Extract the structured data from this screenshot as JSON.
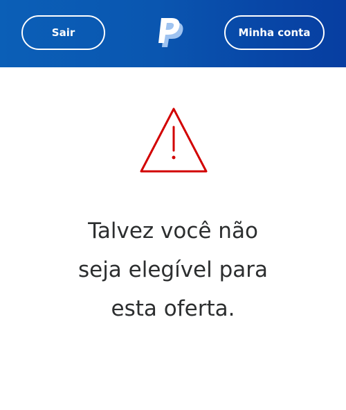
{
  "header": {
    "logout_label": "Sair",
    "account_label": "Minha conta",
    "logo_icon": "paypal-logo-icon",
    "background_color": "#0a56b0"
  },
  "main": {
    "alert_icon": "warning-triangle-icon",
    "alert_color": "#d20000",
    "message_lines": [
      "Talvez você não",
      "seja elegível para",
      "esta oferta."
    ]
  }
}
